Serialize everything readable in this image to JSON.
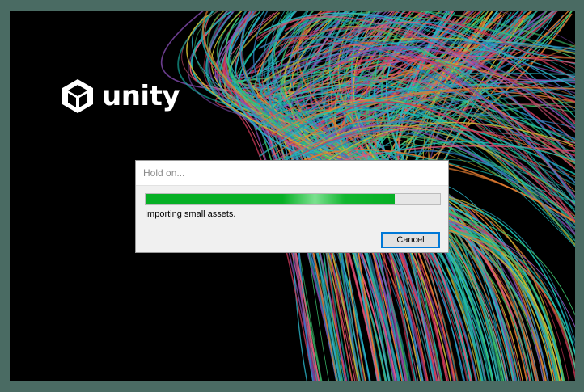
{
  "splash": {
    "logo_text": "unity"
  },
  "dialog": {
    "title": "Hold on...",
    "progress_fraction": 0.845,
    "status_text": "Importing small assets.",
    "cancel_label": "Cancel"
  },
  "colors": {
    "background": "#4a6b63",
    "splash": "#000000",
    "progress": "#06b025",
    "focus_border": "#0078d7"
  }
}
